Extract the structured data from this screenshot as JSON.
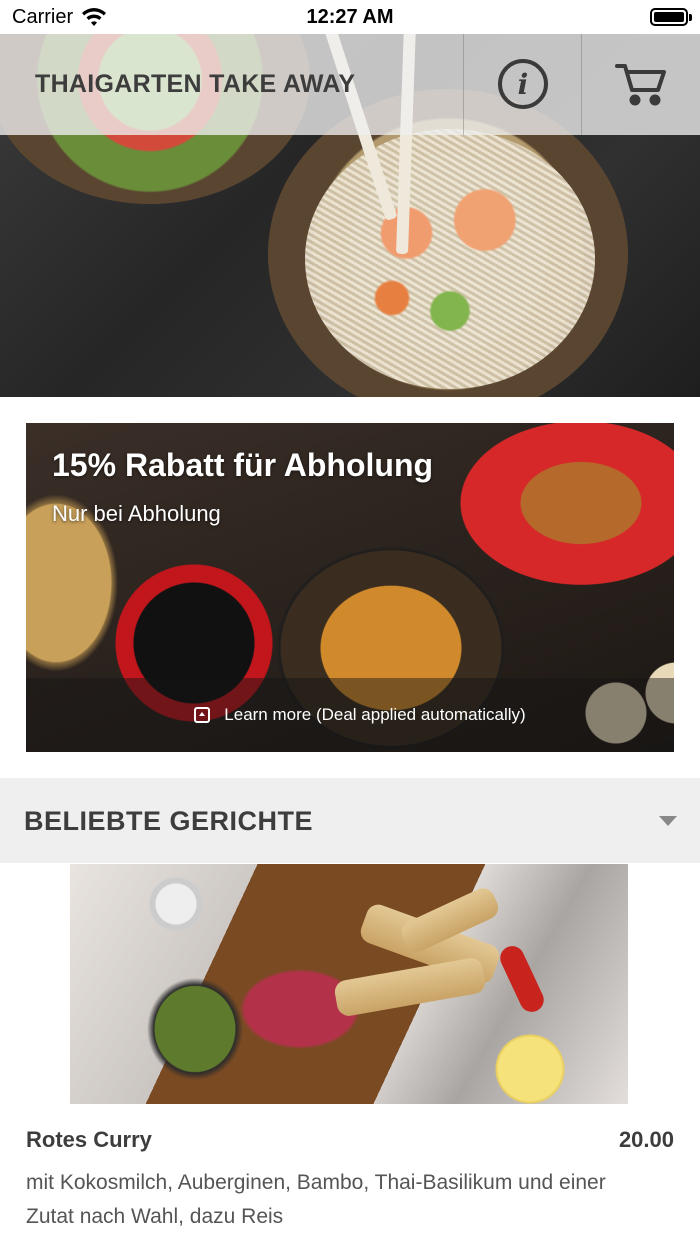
{
  "status_bar": {
    "carrier": "Carrier",
    "time": "12:27 AM"
  },
  "header": {
    "title": "THAIGARTEN TAKE AWAY",
    "info_icon": "info-icon",
    "cart_icon": "cart-icon"
  },
  "deal": {
    "title": "15% Rabatt für Abholung",
    "subtitle": "Nur bei Abholung",
    "learn_more": "Learn more (Deal applied automatically)",
    "expand_icon": "expand-icon"
  },
  "section": {
    "title": "BELIEBTE GERICHTE",
    "chevron_icon": "chevron-down-icon"
  },
  "dish": {
    "name": "Rotes Curry",
    "price": "20.00",
    "description": "mit Kokosmilch, Auberginen, Bambo, Thai-Basilikum und einer Zutat nach Wahl, dazu Reis"
  }
}
